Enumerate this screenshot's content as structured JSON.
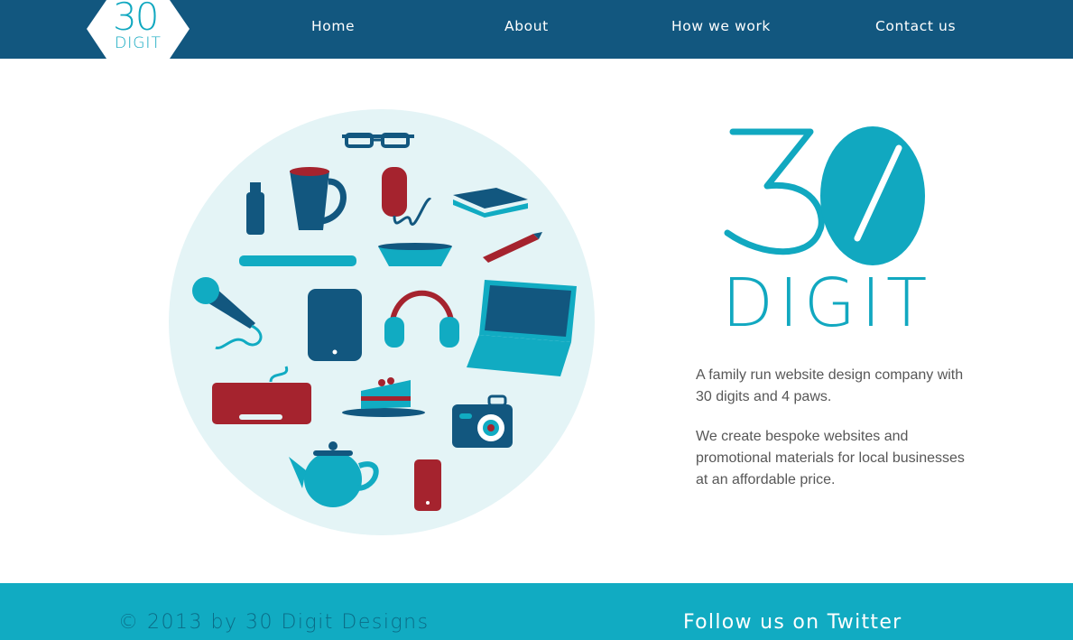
{
  "header": {
    "logo": {
      "number": "30",
      "word": "DIGIT"
    },
    "nav": [
      {
        "label": "Home"
      },
      {
        "label": "About"
      },
      {
        "label": "How we work"
      },
      {
        "label": "Contact us"
      }
    ]
  },
  "hero": {
    "brand": {
      "number": "30",
      "word": "DIGIT"
    },
    "intro_1": "A family run website design company with 30 digits and 4 paws.",
    "intro_2": "We create bespoke websites and promotional materials for local businesses at an affordable price."
  },
  "footer": {
    "copyright": "© 2013 by 30 Digit Designs",
    "twitter": "Follow us on Twitter"
  },
  "colors": {
    "navy": "#12577f",
    "teal": "#11abc2",
    "red": "#a5232e",
    "circle": "#e4f4f6"
  }
}
